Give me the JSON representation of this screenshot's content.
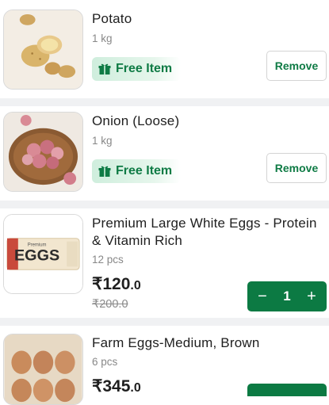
{
  "cart": {
    "items": [
      {
        "title": "Potato",
        "qty": "1 kg",
        "badge": "Free Item",
        "action": "Remove"
      },
      {
        "title": "Onion (Loose)",
        "qty": "1 kg",
        "badge": "Free Item",
        "action": "Remove"
      },
      {
        "title_line1": "Premium Large White Eggs - Protein",
        "title_line2": "& Vitamin Rich",
        "qty": "12 pcs",
        "price_main": "₹120",
        "price_dec": ".0",
        "mrp": "₹200.0",
        "count": "1",
        "minus": "−",
        "plus": "+",
        "carton_text": "EGGS",
        "carton_brand": "Premium"
      },
      {
        "title": "Farm Eggs-Medium, Brown",
        "qty": "6 pcs",
        "price_main": "₹345",
        "price_dec": ".0"
      }
    ]
  },
  "colors": {
    "brand_green": "#0c7a43",
    "free_text": "#0f7b45",
    "muted": "#888888"
  },
  "icons": {
    "gift": "gift-icon",
    "minus": "minus-icon",
    "plus": "plus-icon"
  }
}
